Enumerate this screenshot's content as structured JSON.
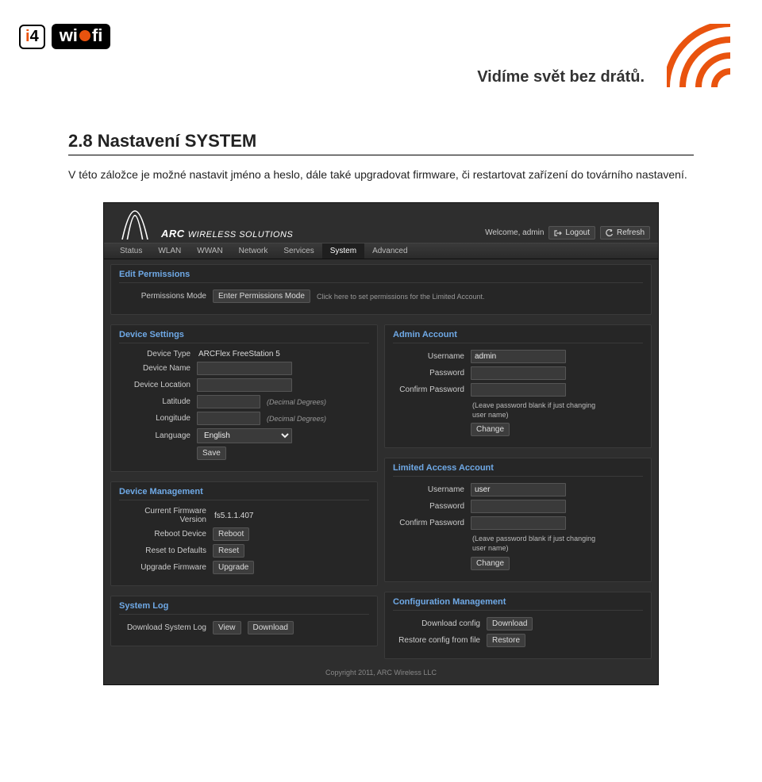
{
  "header": {
    "logo_i": "i",
    "logo_4": "4",
    "logo_wi": "wi",
    "logo_fi": "fi",
    "slogan": "Vidíme svět bez drátů."
  },
  "doc": {
    "title": "2.8 Nastavení SYSTEM",
    "paragraph": "V této záložce je možné nastavit jméno a heslo, dále také upgradovat firmware, či restartovat zařízení do továrního nastavení."
  },
  "app": {
    "brand_main": "ARC",
    "brand_sub": "WIRELESS SOLUTIONS",
    "welcome": "Welcome, admin",
    "logout": "Logout",
    "refresh": "Refresh",
    "tabs": [
      "Status",
      "WLAN",
      "WWAN",
      "Network",
      "Services",
      "System",
      "Advanced"
    ],
    "active_tab_index": 5,
    "edit_permissions": {
      "title": "Edit Permissions",
      "mode_label": "Permissions Mode",
      "mode_button": "Enter Permissions Mode",
      "mode_hint": "Click here to set permissions for the Limited Account."
    },
    "device_settings": {
      "title": "Device Settings",
      "device_type_label": "Device Type",
      "device_type_value": "ARCFlex FreeStation 5",
      "device_name_label": "Device Name",
      "device_name_value": "",
      "device_location_label": "Device Location",
      "device_location_value": "",
      "latitude_label": "Latitude",
      "latitude_value": "",
      "latitude_hint": "(Decimal Degrees)",
      "longitude_label": "Longitude",
      "longitude_value": "",
      "longitude_hint": "(Decimal Degrees)",
      "language_label": "Language",
      "language_value": "English",
      "save": "Save"
    },
    "admin_account": {
      "title": "Admin Account",
      "username_label": "Username",
      "username_value": "admin",
      "password_label": "Password",
      "confirm_label": "Confirm Password",
      "note": "(Leave password blank if just changing user name)",
      "change": "Change"
    },
    "limited_account": {
      "title": "Limited Access Account",
      "username_label": "Username",
      "username_value": "user",
      "password_label": "Password",
      "confirm_label": "Confirm Password",
      "note": "(Leave password blank if just changing user name)",
      "change": "Change"
    },
    "device_mgmt": {
      "title": "Device Management",
      "fw_label": "Current Firmware Version",
      "fw_value": "fs5.1.1.407",
      "reboot_label": "Reboot Device",
      "reboot_btn": "Reboot",
      "reset_label": "Reset to Defaults",
      "reset_btn": "Reset",
      "upgrade_label": "Upgrade Firmware",
      "upgrade_btn": "Upgrade"
    },
    "config_mgmt": {
      "title": "Configuration Management",
      "download_label": "Download config",
      "download_btn": "Download",
      "restore_label": "Restore config from file",
      "restore_btn": "Restore"
    },
    "system_log": {
      "title": "System Log",
      "download_label": "Download System Log",
      "view_btn": "View",
      "download_btn": "Download"
    },
    "footer": "Copyright 2011, ARC Wireless LLC"
  }
}
